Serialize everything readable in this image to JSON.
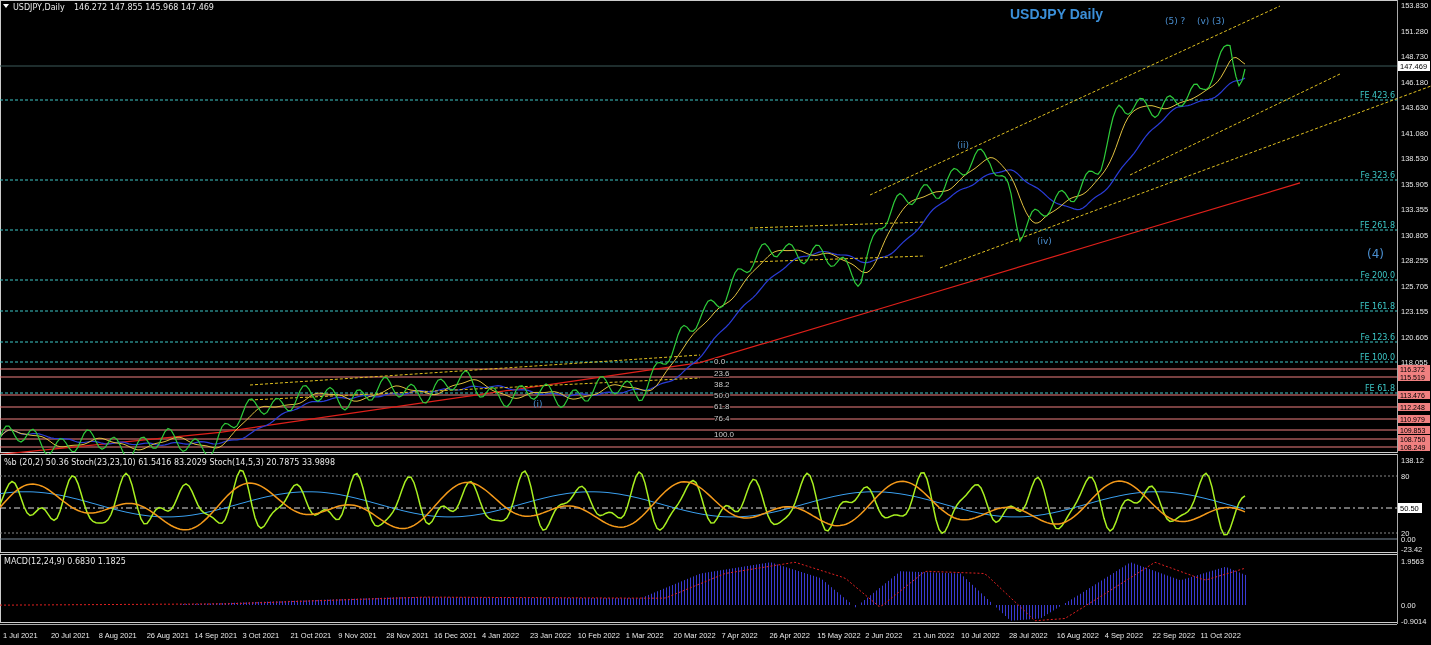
{
  "header": {
    "symbol": "USDJPY,Daily",
    "ohlc": "146.272 147.855 145.968 147.469"
  },
  "chart_title": "USDJPY Daily",
  "wave_labels": [
    "(5) ?",
    "(v)",
    "(3)",
    "(ii)",
    "(iv)",
    "(4)",
    "(i)"
  ],
  "fib_levels": [
    "FE 423.6",
    "Fe 323.6",
    "FE 261.8",
    "Fe 200.0",
    "FE 161.8",
    "Fe 123.6",
    "FE 100.0",
    "FE 61.8"
  ],
  "retracement_labels": [
    "0.0",
    "23.6",
    "38.2",
    "50.0",
    "61.8",
    "76.4",
    "100.0"
  ],
  "price_axis": [
    "153.830",
    "151.280",
    "148.730",
    "146.180",
    "143.630",
    "141.080",
    "138.530",
    "135.905",
    "133.355",
    "130.805",
    "128.255",
    "125.705",
    "123.155",
    "120.605",
    "118.055"
  ],
  "current_price": "147.469",
  "level_tags": [
    "116.372",
    "115.519",
    "113.476",
    "112.248",
    "110.979",
    "109.853",
    "108.750",
    "108.249"
  ],
  "oscillator": {
    "legend": "%b (20,2) 50.36  Stoch(23,23,10) 61.5416 83.2029  Stoch(14,5,3) 20.7875 33.9898",
    "axis": [
      "138.12",
      "80",
      "20",
      "0.00",
      "-23.42"
    ],
    "current": "50.50"
  },
  "macd": {
    "legend": "MACD(12,24,9) 0.6830 1.1825",
    "axis": [
      "1.9563",
      "0.00",
      "-0.9014"
    ]
  },
  "time_axis": [
    "1 Jul 2021",
    "20 Jul 2021",
    "8 Aug 2021",
    "26 Aug 2021",
    "14 Sep 2021",
    "3 Oct 2021",
    "21 Oct 2021",
    "9 Nov 2021",
    "28 Nov 2021",
    "16 Dec 2021",
    "4 Jan 2022",
    "23 Jan 2022",
    "10 Feb 2022",
    "1 Mar 2022",
    "20 Mar 2022",
    "7 Apr 2022",
    "26 Apr 2022",
    "15 May 2022",
    "2 Jun 2022",
    "21 Jun 2022",
    "10 Jul 2022",
    "28 Jul 2022",
    "16 Aug 2022",
    "4 Sep 2022",
    "22 Sep 2022",
    "11 Oct 2022"
  ]
}
